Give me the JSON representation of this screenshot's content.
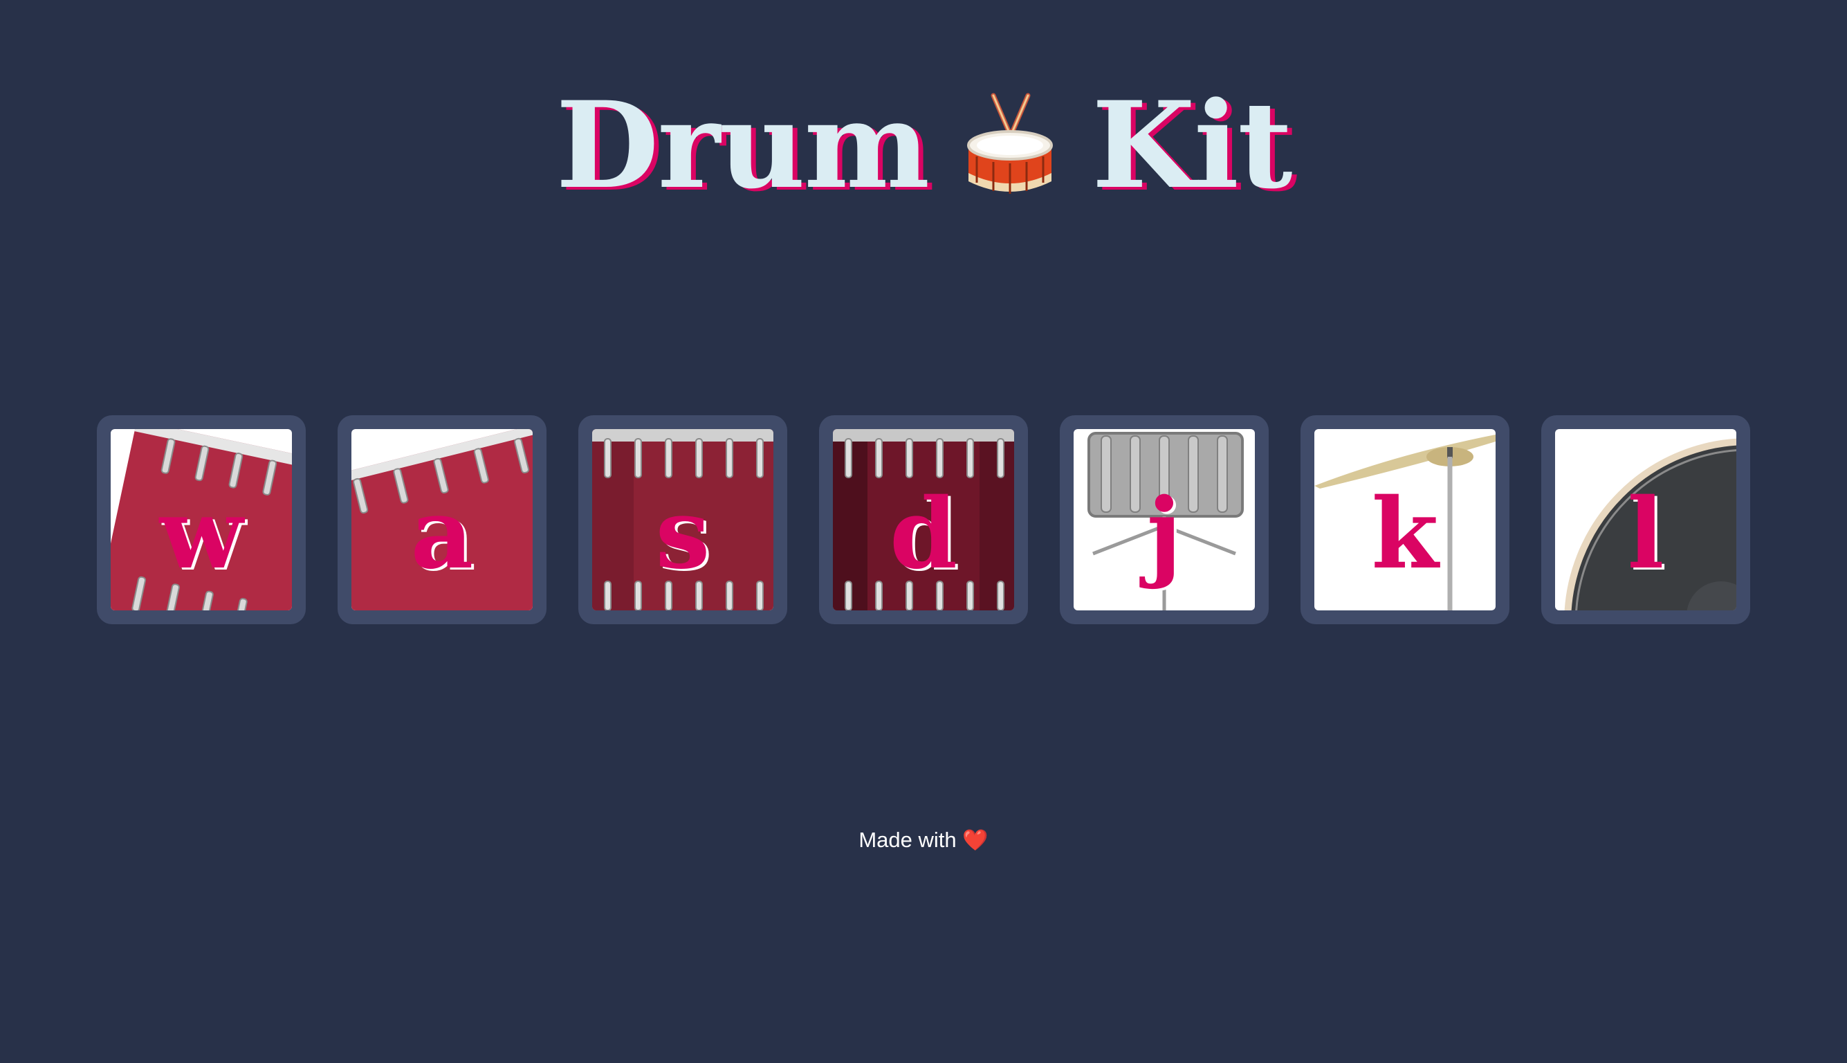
{
  "header": {
    "title_left": "Drum",
    "title_icon": "drum-icon",
    "title_right": "Kit"
  },
  "pads": [
    {
      "key": "w",
      "art": "tilted red drum",
      "icon": "drum-icon"
    },
    {
      "key": "a",
      "art": "tilted red drum",
      "icon": "drum-icon"
    },
    {
      "key": "s",
      "art": "red floor tom",
      "icon": "drum-icon"
    },
    {
      "key": "d",
      "art": "dark red floor tom",
      "icon": "drum-icon"
    },
    {
      "key": "j",
      "art": "silver snare on stand",
      "icon": "snare-icon"
    },
    {
      "key": "k",
      "art": "cymbal on stand",
      "icon": "cymbal-icon"
    },
    {
      "key": "l",
      "art": "bass drum head",
      "icon": "bass-drum-icon"
    }
  ],
  "footer": {
    "text": "Made with",
    "icon": "heart-icon",
    "heart": "❤️"
  },
  "colors": {
    "background": "#283149",
    "pad_frame": "#404b69",
    "accent": "#da0463",
    "title": "#dbedf3"
  }
}
